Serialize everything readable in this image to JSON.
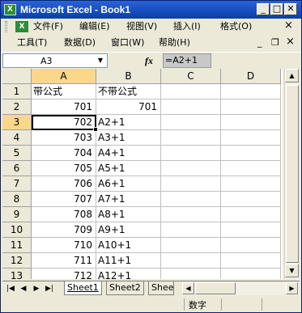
{
  "window": {
    "title": "Microsoft Excel - Book1",
    "app_icon_letter": "X",
    "btn_minimize": "_",
    "btn_maximize": "□",
    "btn_close": "✕"
  },
  "menubar1": {
    "items": [
      "文件(F)",
      "编辑(E)",
      "视图(V)",
      "插入(I)",
      "格式(O)"
    ],
    "right_close": "×"
  },
  "menubar2": {
    "items": [
      "工具(T)",
      "数据(D)",
      "窗口(W)",
      "帮助(H)"
    ],
    "right_min": "_",
    "right_restore": "❐",
    "right_close": "×"
  },
  "formula_bar": {
    "name_box": "A3",
    "fx_label": "fx",
    "formula": "=A2+1"
  },
  "columns": [
    "A",
    "B",
    "C",
    "D"
  ],
  "rows": [
    {
      "n": "1",
      "a": "带公式",
      "b": "不带公式"
    },
    {
      "n": "2",
      "a": "701",
      "b": "701"
    },
    {
      "n": "3",
      "a": "702",
      "b": "A2+1"
    },
    {
      "n": "4",
      "a": "703",
      "b": "A3+1"
    },
    {
      "n": "5",
      "a": "704",
      "b": "A4+1"
    },
    {
      "n": "6",
      "a": "705",
      "b": "A5+1"
    },
    {
      "n": "7",
      "a": "706",
      "b": "A6+1"
    },
    {
      "n": "8",
      "a": "707",
      "b": "A7+1"
    },
    {
      "n": "9",
      "a": "708",
      "b": "A8+1"
    },
    {
      "n": "10",
      "a": "709",
      "b": "A9+1"
    },
    {
      "n": "11",
      "a": "710",
      "b": "A10+1"
    },
    {
      "n": "12",
      "a": "711",
      "b": "A11+1"
    },
    {
      "n": "13",
      "a": "712",
      "b": "A12+1"
    }
  ],
  "sheet_tabs": [
    "Sheet1",
    "Sheet2",
    "Shee"
  ],
  "status": "数字"
}
